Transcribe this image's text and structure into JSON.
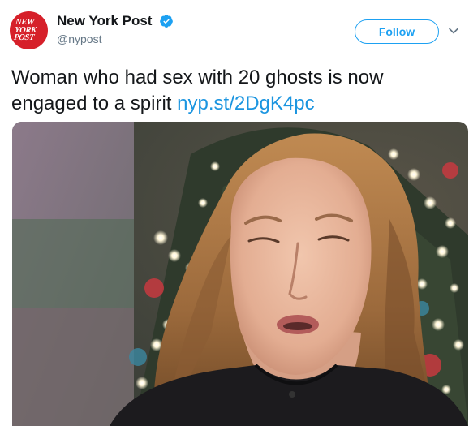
{
  "tweet": {
    "author": {
      "display_name": "New York Post",
      "handle": "@nypost",
      "verified": true,
      "avatar_logo_lines": [
        "NEW",
        "YORK",
        "POST"
      ],
      "avatar_color": "#d6202a"
    },
    "follow_label": "Follow",
    "text": "Woman who had sex with 20 ghosts is now engaged to a spirit",
    "link_text": "nyp.st/2DgK4pc",
    "icons": {
      "verified": "verified-badge-icon",
      "menu": "chevron-down-icon"
    },
    "colors": {
      "accent": "#1da1f2",
      "link": "#1b95e0",
      "text": "#14171a",
      "secondary": "#657786"
    }
  }
}
